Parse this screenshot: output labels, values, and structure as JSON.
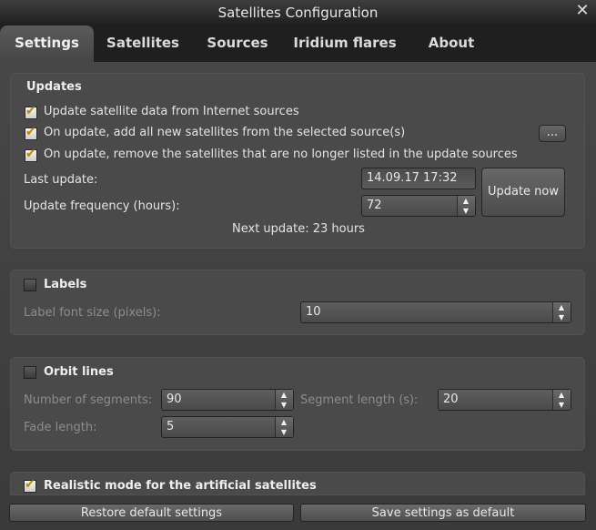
{
  "window": {
    "title": "Satellites Configuration",
    "close_glyph": "✕"
  },
  "tabs": [
    "Settings",
    "Satellites",
    "Sources",
    "Iridium flares",
    "About"
  ],
  "updates": {
    "title": "Updates",
    "opt_update_internet": "Update satellite data from Internet sources",
    "opt_add_new": "On update, add all new satellites from the selected source(s)",
    "opt_remove_unlisted": "On update, remove the satellites that are no longer listed in the update sources",
    "ellipsis_label": "...",
    "last_update_label": "Last update:",
    "last_update_value": "14.09.17 17:32",
    "frequency_label": "Update frequency (hours):",
    "frequency_value": "72",
    "update_now_label": "Update now",
    "next_update_text": "Next update: 23 hours"
  },
  "labels": {
    "title": "Labels",
    "font_size_label": "Label font size (pixels):",
    "font_size_value": "10"
  },
  "orbit": {
    "title": "Orbit lines",
    "segments_label": "Number of  segments:",
    "segments_value": "90",
    "segment_length_label": "Segment length (s):",
    "segment_length_value": "20",
    "fade_length_label": "Fade length:",
    "fade_length_value": "5"
  },
  "realistic": {
    "title": "Realistic mode for the artificial satellites"
  },
  "footer": {
    "restore_label": "Restore default settings",
    "save_label": "Save settings as default"
  },
  "colors": {
    "accent_tick": "#b88a00",
    "background": "#2b2b2b"
  }
}
